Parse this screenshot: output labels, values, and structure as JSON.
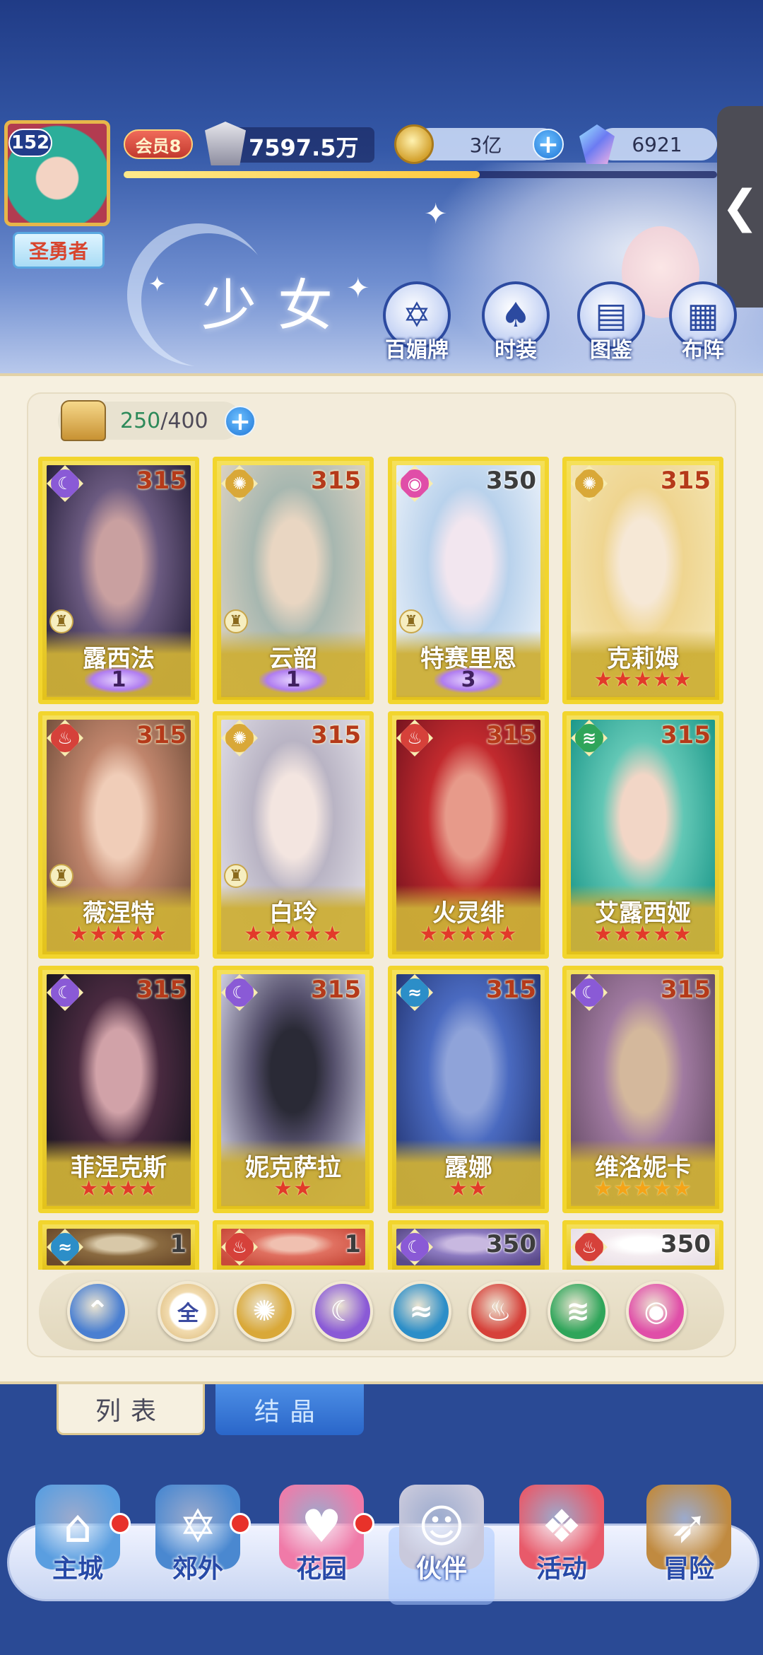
{
  "player": {
    "level": "152",
    "title": "圣勇者",
    "vip": "会员8",
    "power": "7597.5万",
    "xp_progress": 0.6,
    "gold": "3亿",
    "gems": "6921"
  },
  "header": {
    "page_title": "少女",
    "features": [
      {
        "label": "百媚牌",
        "icon": "card-badge-icon"
      },
      {
        "label": "时装",
        "icon": "costume-icon"
      },
      {
        "label": "图鉴",
        "icon": "codex-book-icon"
      },
      {
        "label": "布阵",
        "icon": "formation-grid-icon"
      }
    ]
  },
  "inventory": {
    "current": "250",
    "separator": "/",
    "max": "400"
  },
  "cards": [
    {
      "name": "露西法",
      "level": "315",
      "element": "moon",
      "awaken": "1",
      "stars": "",
      "art": [
        "#2b2440",
        "#6b5a80",
        "#c9a0a0"
      ]
    },
    {
      "name": "云韶",
      "level": "315",
      "element": "light",
      "awaken": "1",
      "stars": "",
      "art": [
        "#d8d0c0",
        "#a7b7b0",
        "#e9d6c2"
      ]
    },
    {
      "name": "特赛里恩",
      "level": "350",
      "element": "heart",
      "awaken": "3",
      "stars": "",
      "art": [
        "#e6eef8",
        "#b9d2ec",
        "#f2e6ef"
      ]
    },
    {
      "name": "克莉姆",
      "level": "315",
      "element": "light",
      "awaken": "",
      "stars": "★★★★★",
      "art": [
        "#f3e3b0",
        "#efd590",
        "#f6e8d6"
      ]
    },
    {
      "name": "薇涅特",
      "level": "315",
      "element": "fire",
      "awaken": "",
      "stars": "★★★★★",
      "art": [
        "#7a5440",
        "#c0856c",
        "#f0cdb8"
      ]
    },
    {
      "name": "白玲",
      "level": "315",
      "element": "light",
      "awaken": "",
      "stars": "★★★★★",
      "art": [
        "#dedbe4",
        "#b9b4c4",
        "#f3e5e0"
      ]
    },
    {
      "name": "火灵绯",
      "level": "315",
      "element": "fire",
      "awaken": "",
      "stars": "★★★★★",
      "art": [
        "#7b1520",
        "#c22a2e",
        "#e79a8a"
      ]
    },
    {
      "name": "艾露西娅",
      "level": "315",
      "element": "wind",
      "awaken": "",
      "stars": "★★★★★",
      "art": [
        "#1f9a8c",
        "#62c7b5",
        "#f2d6c6"
      ]
    },
    {
      "name": "菲涅克斯",
      "level": "315",
      "element": "moon",
      "awaken": "",
      "stars": "★★★★",
      "art": [
        "#1c1622",
        "#4a2a40",
        "#d1a2a8"
      ]
    },
    {
      "name": "妮克萨拉",
      "level": "315",
      "element": "moon",
      "awaken": "",
      "stars": "★★",
      "art": [
        "#c8c7da",
        "#55506c",
        "#2a2a36"
      ]
    },
    {
      "name": "露娜",
      "level": "315",
      "element": "water",
      "awaken": "",
      "stars": "★★",
      "art": [
        "#273a7a",
        "#4a6ac0",
        "#8fa3d9"
      ]
    },
    {
      "name": "维洛妮卡",
      "level": "315",
      "element": "moon",
      "awaken": "",
      "stars": "★★★★★",
      "art": [
        "#6a4f6a",
        "#a07aa0",
        "#d4b89c"
      ]
    },
    {
      "name": "",
      "level": "1",
      "element": "water",
      "awaken": "",
      "stars": "",
      "art": [
        "#6b4a2a",
        "#8a6a40",
        "#d8c8a8"
      ]
    },
    {
      "name": "",
      "level": "1",
      "element": "fire",
      "awaken": "",
      "stars": "",
      "art": [
        "#c84a3a",
        "#e07060",
        "#f0c0b0"
      ]
    },
    {
      "name": "",
      "level": "350",
      "element": "moon",
      "awaken": "",
      "stars": "",
      "art": [
        "#5a4a8a",
        "#8c7ac0",
        "#c8b8e0"
      ]
    },
    {
      "name": "",
      "level": "350",
      "element": "fire",
      "awaken": "",
      "stars": "",
      "art": [
        "#e8e0e8",
        "#f4ecf0",
        "#ffffff"
      ]
    }
  ],
  "element_colors": {
    "moon": "#8a5ad6",
    "light": "#d9a838",
    "heart": "#e04ea8",
    "fire": "#d6413a",
    "wind": "#2fa55a",
    "water": "#2c8ec8"
  },
  "filters": [
    {
      "id": "collapse",
      "label": "",
      "icon": "chevron-up-icon",
      "color": "#4a7fd1"
    },
    {
      "id": "all",
      "label": "全",
      "icon": "all-icon",
      "color": "#f2dcb0"
    },
    {
      "id": "light",
      "label": "",
      "icon": "sun-icon",
      "color": "#d9a838"
    },
    {
      "id": "moon",
      "label": "",
      "icon": "moon-icon",
      "color": "#8a5ad6"
    },
    {
      "id": "water",
      "label": "",
      "icon": "water-drop-icon",
      "color": "#2c8ec8"
    },
    {
      "id": "fire",
      "label": "",
      "icon": "flame-icon",
      "color": "#d6413a"
    },
    {
      "id": "wind",
      "label": "",
      "icon": "tornado-icon",
      "color": "#2fa55a"
    },
    {
      "id": "heart",
      "label": "",
      "icon": "heart-orb-icon",
      "color": "#e04ea8"
    }
  ],
  "tabs": {
    "list": "列表",
    "crystal": "结晶"
  },
  "nav": [
    {
      "label": "主城",
      "icon": "castle-icon",
      "badge": true,
      "color": "#5a9ee0"
    },
    {
      "label": "郊外",
      "icon": "portal-icon",
      "badge": true,
      "color": "#4a88d0"
    },
    {
      "label": "花园",
      "icon": "heart-garden-icon",
      "badge": true,
      "color": "#f07aa8"
    },
    {
      "label": "伙伴",
      "icon": "companion-icon",
      "badge": false,
      "color": "#c9c9dc"
    },
    {
      "label": "活动",
      "icon": "gift-box-icon",
      "badge": false,
      "color": "#e85a6a"
    },
    {
      "label": "冒险",
      "icon": "compass-icon",
      "badge": false,
      "color": "#c08a40"
    }
  ]
}
